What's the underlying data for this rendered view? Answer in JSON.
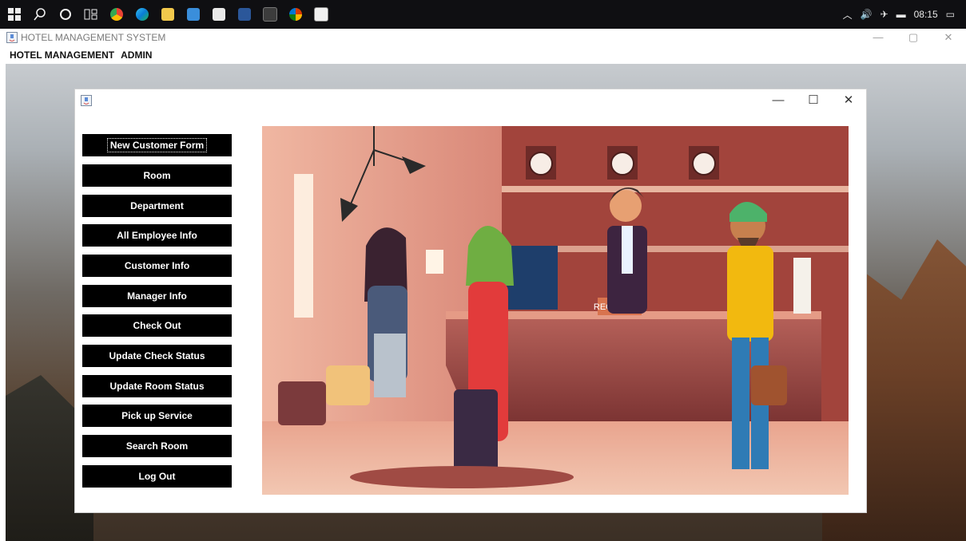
{
  "taskbar": {
    "clock": "08:15",
    "icons": [
      "windows-icon",
      "search-icon",
      "cortana-icon",
      "task-view-icon",
      "chrome-icon",
      "edge-icon",
      "file-explorer-icon",
      "mail-icon",
      "store-icon",
      "word-icon",
      "terminal-icon",
      "office-icon",
      "java-icon"
    ],
    "tray_icons": [
      "chevron-up-icon",
      "volume-icon",
      "network-icon",
      "battery-icon",
      "notification-icon"
    ]
  },
  "window": {
    "title": "HOTEL MANAGEMENT SYSTEM",
    "controls": {
      "minimize": "—",
      "maximize": "▢",
      "close": "✕"
    }
  },
  "menubar": {
    "items": [
      "HOTEL MANAGEMENT",
      "ADMIN"
    ]
  },
  "inner_window": {
    "controls": {
      "minimize": "—",
      "maximize": "☐",
      "close": "✕"
    },
    "buttons": [
      "New Customer Form",
      "Room",
      "Department",
      "All Employee Info",
      "Customer Info",
      "Manager Info",
      "Check Out",
      "Update Check Status",
      "Update Room Status",
      "Pick up Service",
      "Search Room",
      "Log Out"
    ],
    "reception_sign": "RECEPTION"
  },
  "colors": {
    "taskbar": "#0f0f12",
    "button_bg": "#000000",
    "button_text": "#ffffff",
    "illustration_wall": "#b3523f",
    "desk": "#9c4a42"
  }
}
